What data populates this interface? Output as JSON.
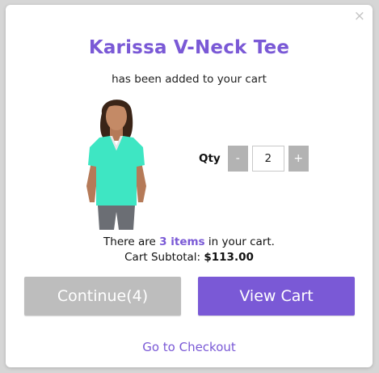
{
  "modal": {
    "close_icon": "close-icon",
    "close_glyph": "×",
    "product_title": "Karissa V-Neck Tee",
    "added_text": "has been added to your cart",
    "product_image_icon": "product-image-woman-in-mint-tee",
    "qty": {
      "label": "Qty",
      "minus": "-",
      "value": "2",
      "plus": "+"
    },
    "cart_summary": {
      "prefix": "There are ",
      "items": "3 items",
      "suffix": " in your cart.",
      "subtotal_label": "Cart Subtotal: ",
      "subtotal_value": "$113.00"
    },
    "buttons": {
      "continue": "Continue(4)",
      "view_cart": "View Cart"
    },
    "checkout_link": "Go to Checkout"
  },
  "colors": {
    "accent": "#7a59d6",
    "button_disabled": "#bdbdbd",
    "qty_button": "#b3b3b3",
    "shirt": "#3ee6c3"
  }
}
